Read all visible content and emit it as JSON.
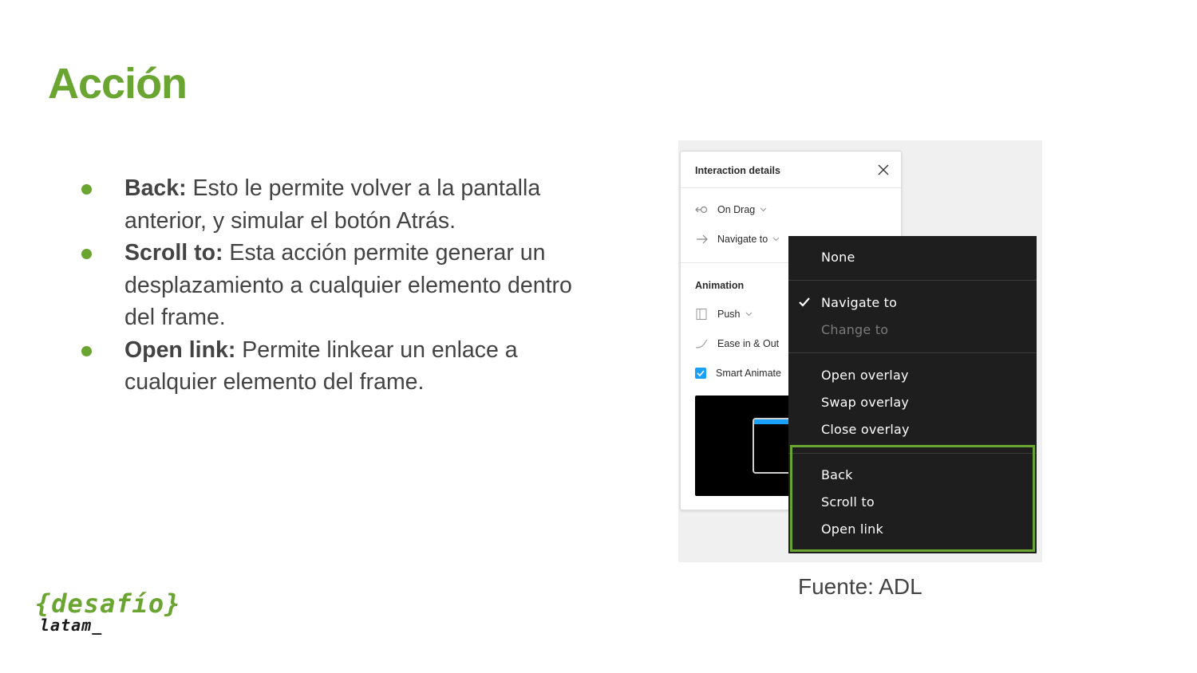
{
  "colors": {
    "accent": "#6aa431",
    "text": "#434343",
    "menu_bg": "#1e1e1e",
    "checkbox_blue": "#18a0fb"
  },
  "slide": {
    "title": "Acción",
    "bullets": [
      {
        "term": "Back:",
        "text": " Esto le permite volver a la pantalla anterior, y simular el botón Atrás."
      },
      {
        "term": "Scroll to:",
        "text": " Esta acción permite generar un desplazamiento a cualquier elemento dentro del frame."
      },
      {
        "term": "Open link:",
        "text": " Permite linkear un enlace a cualquier elemento del frame."
      }
    ],
    "caption": "Fuente: ADL"
  },
  "panel": {
    "title": "Interaction details",
    "trigger": "On Drag",
    "action": "Navigate to",
    "animation_label": "Animation",
    "transition": "Push",
    "easing": "Ease in & Out",
    "smart_animate": "Smart Animate",
    "icons": [
      "close-icon",
      "drag-icon",
      "arrow-right-icon",
      "push-icon",
      "ease-curve-icon",
      "check-icon",
      "chevron-down-icon"
    ]
  },
  "menu": {
    "group1": [
      "None"
    ],
    "group2": [
      {
        "label": "Navigate to",
        "checked": true,
        "disabled": false
      },
      {
        "label": "Change to",
        "checked": false,
        "disabled": true
      }
    ],
    "group3": [
      "Open overlay",
      "Swap overlay",
      "Close overlay"
    ],
    "group4": [
      "Back",
      "Scroll to",
      "Open link"
    ]
  },
  "logo": {
    "top": "{desafío}",
    "bottom": "latam_"
  }
}
